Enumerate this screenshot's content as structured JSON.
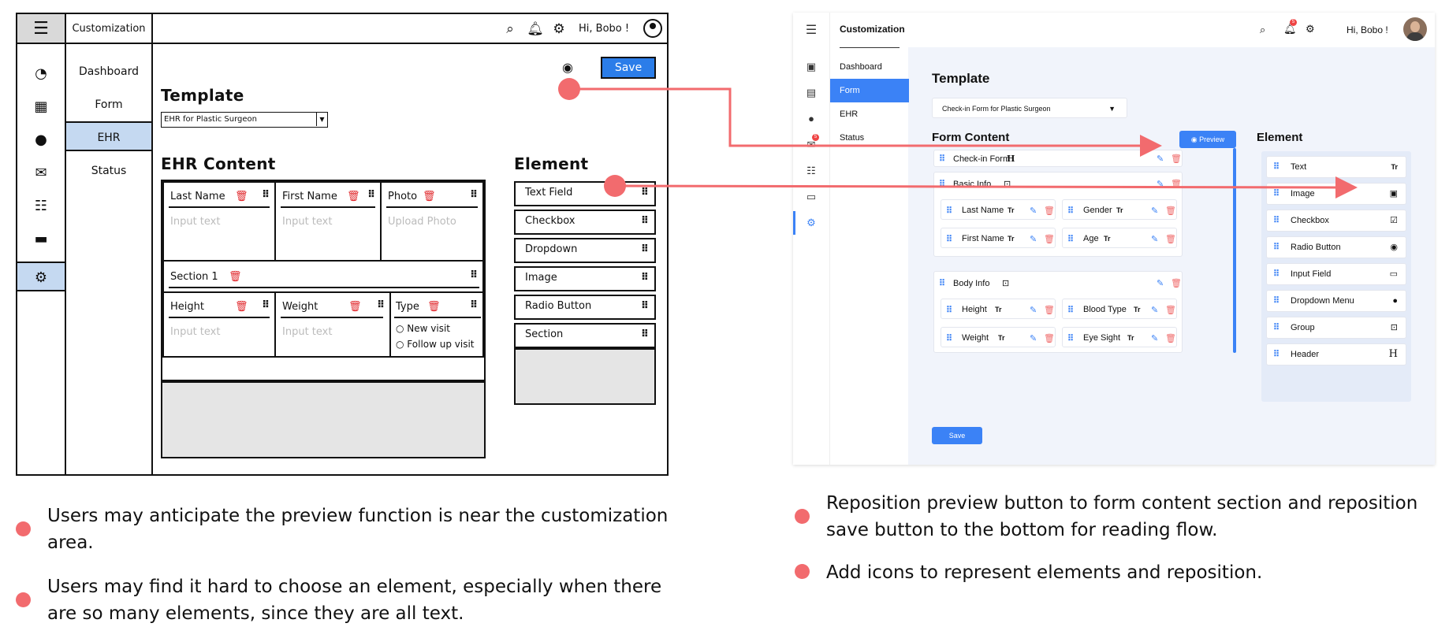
{
  "wireframe": {
    "nav_title": "Customization",
    "greeting": "Hi, Bobo !",
    "nav_items": [
      "Dashboard",
      "Form",
      "EHR",
      "Status"
    ],
    "save_label": "Save",
    "template_heading": "Template",
    "template_select": "EHR for Plastic Surgeon",
    "content_heading": "EHR Content",
    "element_heading": "Element",
    "fields_row1": [
      {
        "label": "Last Name",
        "placeholder": "Input text"
      },
      {
        "label": "First Name",
        "placeholder": "Input text"
      },
      {
        "label": "Photo",
        "placeholder": "Upload Photo"
      }
    ],
    "section_label": "Section 1",
    "fields_row2": [
      {
        "label": "Height",
        "placeholder": "Input text"
      },
      {
        "label": "Weight",
        "placeholder": "Input text"
      }
    ],
    "type_field": {
      "label": "Type",
      "options": [
        "New visit",
        "Follow up visit"
      ]
    },
    "elements": [
      "Text Field",
      "Checkbox",
      "Dropdown",
      "Image",
      "Radio Button",
      "Section"
    ]
  },
  "mockup": {
    "nav_title": "Customization",
    "greeting": "Hi, Bobo !",
    "notification_count": "5",
    "mail_count": "5",
    "nav_items": [
      "Dashboard",
      "Form",
      "EHR",
      "Status"
    ],
    "template_heading": "Template",
    "template_select": "Check-in Form for Plastic Surgeon",
    "content_heading": "Form Content",
    "preview_label": "Preview",
    "element_heading": "Element",
    "header_row": "Check-in Form",
    "groups": [
      {
        "title": "Basic Info",
        "fields": [
          "Last Name",
          "Gender",
          "First Name",
          "Age"
        ]
      },
      {
        "title": "Body Info",
        "fields": [
          "Height",
          "Blood Type",
          "Weight",
          "Eye Sight"
        ]
      }
    ],
    "save_label": "Save",
    "elements": [
      {
        "label": "Text",
        "icon": "Tr"
      },
      {
        "label": "Image",
        "icon": "image-icon"
      },
      {
        "label": "Checkbox",
        "icon": "checkbox-icon"
      },
      {
        "label": "Radio Button",
        "icon": "radio-icon"
      },
      {
        "label": "Input Field",
        "icon": "input-field-icon"
      },
      {
        "label": "Dropdown Menu",
        "icon": "dropdown-icon"
      },
      {
        "label": "Group",
        "icon": "group-icon"
      },
      {
        "label": "Header",
        "icon": "H"
      }
    ]
  },
  "notes_left": [
    "Users may anticipate the preview function is near the customization area.",
    "Users may find it hard to choose an element, especially when there are so many elements, since they are all text."
  ],
  "notes_right": [
    "Reposition preview button to form content section and reposition save button to the bottom for reading flow.",
    "Add icons to represent elements and reposition."
  ],
  "colors": {
    "accent": "#3b82f6",
    "arrow": "#f26b6e",
    "delete": "#e0262a",
    "wire_highlight": "#c5d9f1"
  }
}
